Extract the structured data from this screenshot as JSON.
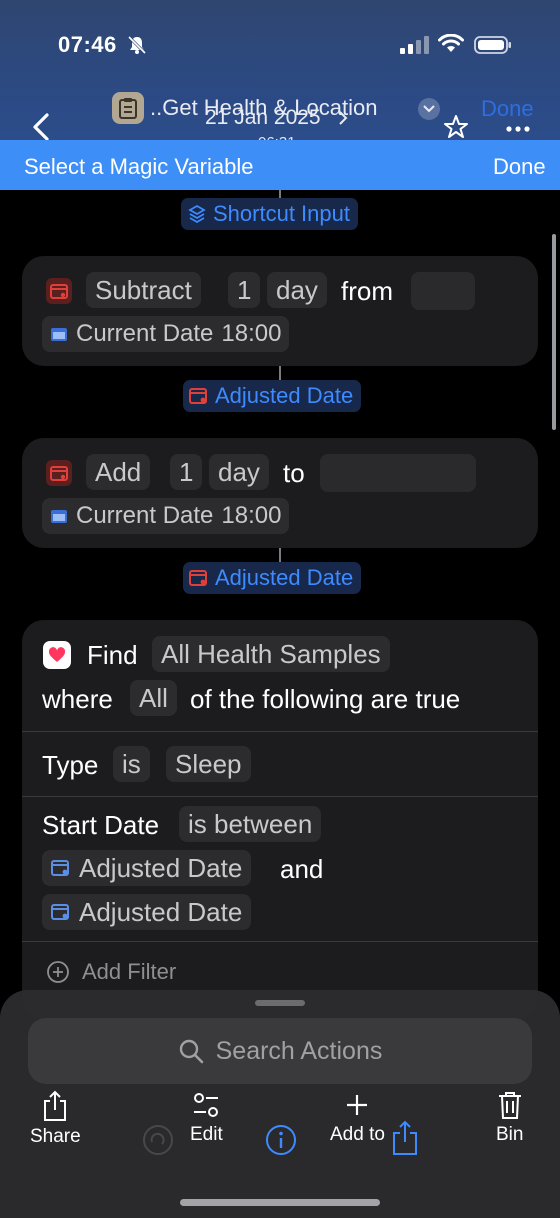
{
  "status_bar": {
    "time": "07:46"
  },
  "header": {
    "title": "..Get Health & Location",
    "overlay_date": "21 Jan 2025",
    "subtime": "06:31",
    "done_label": "Done"
  },
  "magic_bar": {
    "title": "Select a Magic Variable",
    "done_label": "Done"
  },
  "shortcut_input_label": "Shortcut Input",
  "action_subtract": {
    "verb": "Subtract",
    "amount": "1",
    "unit": "day",
    "preposition": "from",
    "date_label": "Current Date",
    "date_time": "18:00",
    "output_label": "Adjusted Date"
  },
  "action_add": {
    "verb": "Add",
    "amount": "1",
    "unit": "day",
    "preposition": "to",
    "date_label": "Current Date",
    "date_time": "18:00",
    "output_label": "Adjusted Date"
  },
  "find_action": {
    "verb": "Find",
    "target": "All Health Samples",
    "where_label": "where",
    "quantifier": "All",
    "condition_text": "of the following are true",
    "filter_type": {
      "field": "Type",
      "operator": "is",
      "value": "Sleep"
    },
    "filter_date": {
      "field": "Start Date",
      "operator": "is between",
      "value_a": "Adjusted Date",
      "joiner": "and",
      "value_b": "Adjusted Date"
    },
    "add_filter_label": "Add Filter"
  },
  "bottom_sheet": {
    "search_placeholder": "Search Actions",
    "toolbar": {
      "share_label": "Share",
      "edit_label": "Edit",
      "add_to_label": "Add to",
      "bin_label": "Bin"
    }
  },
  "colors": {
    "accent_blue": "#3e8ef7",
    "variable_blue": "#3d8bff",
    "calc_red": "#e0403a",
    "health_pink": "#ff375f"
  }
}
